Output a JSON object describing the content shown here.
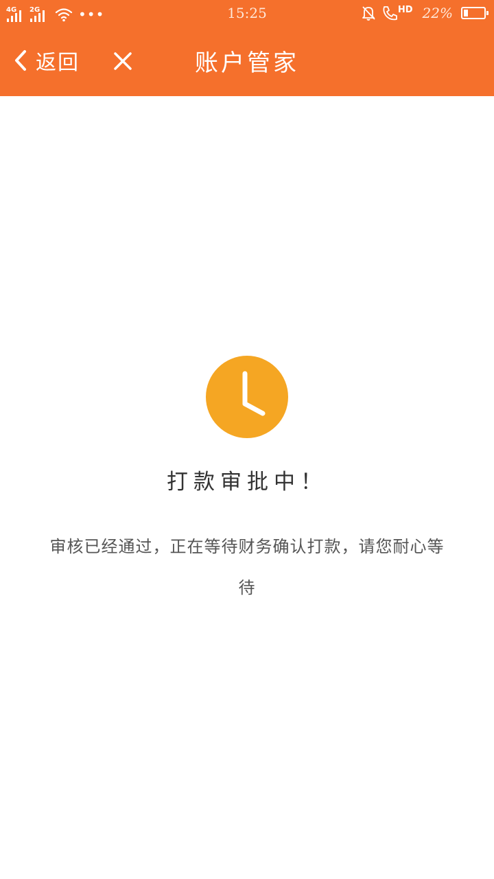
{
  "status_bar": {
    "network_1": "4G",
    "network_2": "2G",
    "time": "15:25",
    "hd_label": "HD",
    "battery_percent": "22%",
    "battery_level": 0.22
  },
  "nav": {
    "back_label": "返回",
    "title": "账户管家"
  },
  "main": {
    "status_title": "打款审批中！",
    "description": "审核已经通过，正在等待财务确认打款，请您耐心等待"
  },
  "colors": {
    "header": "#F5702C",
    "clock": "#F5A623",
    "background": "#FFFFFF"
  },
  "icons": {
    "back": "chevron-left-icon",
    "close": "close-icon",
    "clock": "clock-icon",
    "wifi": "wifi-icon",
    "mute": "bell-off-icon",
    "call": "phone-icon",
    "battery": "battery-icon"
  }
}
